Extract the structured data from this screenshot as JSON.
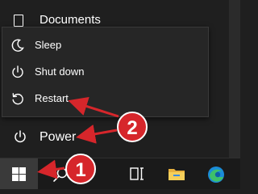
{
  "start_menu": {
    "documents_label": "Documents",
    "power_label": "Power"
  },
  "power_menu": {
    "items": [
      {
        "label": "Sleep",
        "icon": "moon-icon"
      },
      {
        "label": "Shut down",
        "icon": "power-icon"
      },
      {
        "label": "Restart",
        "icon": "restart-icon"
      }
    ]
  },
  "taskbar": {
    "icons": [
      "windows-start-icon",
      "search-icon",
      "task-view-icon",
      "file-explorer-icon",
      "edge-icon"
    ]
  },
  "annotations": {
    "badges": [
      "1",
      "2"
    ],
    "badge_color": "#d6262b",
    "arrow_color": "#d6262b"
  }
}
